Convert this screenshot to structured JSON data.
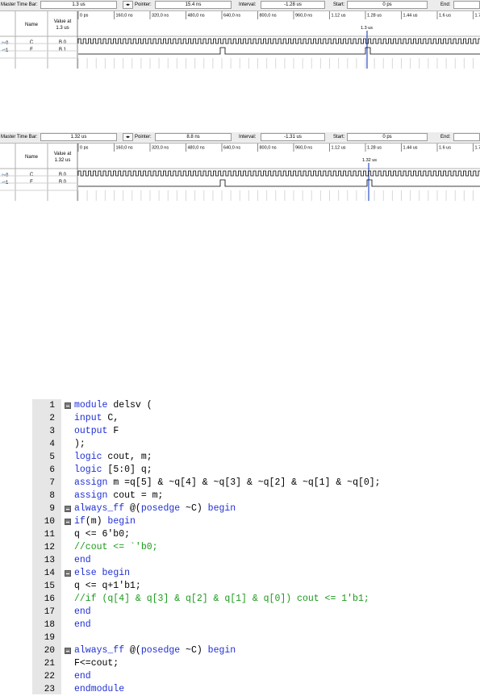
{
  "panels": [
    {
      "master_time_bar_label": "Master Time Bar:",
      "master_time_bar_value": "1.3 us",
      "pointer_label": "Pointer:",
      "pointer_value": "15.4 ns",
      "interval_label": "Interval:",
      "interval_value": "-1.28 us",
      "start_label": "Start:",
      "start_value": "0 ps",
      "end_label": "End:",
      "end_value": "",
      "name_header": "Name",
      "value_header": "Value at",
      "value_header_time": "1.3 us",
      "time_ticks": [
        "0 ps",
        "160,0 ns",
        "320,0 ns",
        "480,0 ns",
        "640,0 ns",
        "800,0 ns",
        "960,0 ns",
        "1.12 us",
        "1.28 us",
        "1.44 us",
        "1.6 us",
        "1.76 us"
      ],
      "cursor_label": "1.3 us",
      "signals": [
        {
          "index": "0",
          "name": "C",
          "value": "B 0"
        },
        {
          "index": "1",
          "name": "F",
          "value": "B 1"
        }
      ]
    },
    {
      "master_time_bar_label": "Master Time Bar:",
      "master_time_bar_value": "1.32 us",
      "pointer_label": "Pointer:",
      "pointer_value": "8.8 ns",
      "interval_label": "Interval:",
      "interval_value": "-1.31 us",
      "start_label": "Start:",
      "start_value": "0 ps",
      "end_label": "End:",
      "end_value": "",
      "name_header": "Name",
      "value_header": "Value at",
      "value_header_time": "1.32 us",
      "time_ticks": [
        "0 ps",
        "160,0 ns",
        "320,0 ns",
        "480,0 ns",
        "640,0 ns",
        "800,0 ns",
        "960,0 ns",
        "1.12 us",
        "1.28 us",
        "1.44 us",
        "1.6 us",
        "1.76 us"
      ],
      "cursor_label": "1.32 us",
      "signals": [
        {
          "index": "0",
          "name": "C",
          "value": "B 0"
        },
        {
          "index": "1",
          "name": "F",
          "value": "B 0"
        }
      ]
    }
  ],
  "code_lines": [
    {
      "n": "1",
      "fold": true,
      "segs": [
        [
          "kw",
          "module"
        ],
        [
          "pl",
          " delsv ("
        ]
      ]
    },
    {
      "n": "2",
      "fold": false,
      "segs": [
        [
          "kw",
          "input"
        ],
        [
          "pl",
          " C,"
        ]
      ]
    },
    {
      "n": "3",
      "fold": false,
      "segs": [
        [
          "kw",
          "output"
        ],
        [
          "pl",
          " F"
        ]
      ]
    },
    {
      "n": "4",
      "fold": false,
      "segs": [
        [
          "pl",
          ");"
        ]
      ]
    },
    {
      "n": "5",
      "fold": false,
      "segs": [
        [
          "kw",
          "logic"
        ],
        [
          "pl",
          " cout, m;"
        ]
      ]
    },
    {
      "n": "6",
      "fold": false,
      "segs": [
        [
          "kw",
          "logic"
        ],
        [
          "pl",
          " [5:0] q;"
        ]
      ]
    },
    {
      "n": "7",
      "fold": false,
      "segs": [
        [
          "kw",
          "assign"
        ],
        [
          "pl",
          " m =q[5] & ~q[4] & ~q[3] & ~q[2] & ~q[1] & ~q[0];"
        ]
      ]
    },
    {
      "n": "8",
      "fold": false,
      "segs": [
        [
          "kw",
          "assign"
        ],
        [
          "pl",
          " cout = m;"
        ]
      ]
    },
    {
      "n": "9",
      "fold": true,
      "segs": [
        [
          "kw",
          "always_ff"
        ],
        [
          "pl",
          " @("
        ],
        [
          "kw",
          "posedge"
        ],
        [
          "pl",
          " ~C) "
        ],
        [
          "kw",
          "begin"
        ]
      ]
    },
    {
      "n": "10",
      "fold": true,
      "segs": [
        [
          "kw",
          "if"
        ],
        [
          "pl",
          "(m) "
        ],
        [
          "kw",
          "begin"
        ]
      ]
    },
    {
      "n": "11",
      "fold": false,
      "segs": [
        [
          "pl",
          "q <= 6'b0;"
        ]
      ]
    },
    {
      "n": "12",
      "fold": false,
      "segs": [
        [
          "cm",
          "//cout <= `'b0;"
        ]
      ]
    },
    {
      "n": "13",
      "fold": false,
      "segs": [
        [
          "kw",
          "end"
        ]
      ]
    },
    {
      "n": "14",
      "fold": true,
      "segs": [
        [
          "kw",
          "else"
        ],
        [
          "pl",
          " "
        ],
        [
          "kw",
          "begin"
        ]
      ]
    },
    {
      "n": "15",
      "fold": false,
      "segs": [
        [
          "pl",
          "q <= q+1'b1;"
        ]
      ]
    },
    {
      "n": "16",
      "fold": false,
      "segs": [
        [
          "cm",
          "//if (q[4] & q[3] & q[2] & q[1] & q[0]) cout <= 1'b1;"
        ]
      ]
    },
    {
      "n": "17",
      "fold": false,
      "segs": [
        [
          "kw",
          "end"
        ]
      ]
    },
    {
      "n": "18",
      "fold": false,
      "segs": [
        [
          "kw",
          "end"
        ]
      ]
    },
    {
      "n": "19",
      "fold": false,
      "segs": []
    },
    {
      "n": "20",
      "fold": true,
      "segs": [
        [
          "kw",
          "always_ff"
        ],
        [
          "pl",
          " @("
        ],
        [
          "kw",
          "posedge"
        ],
        [
          "pl",
          " ~C) "
        ],
        [
          "kw",
          "begin"
        ]
      ]
    },
    {
      "n": "21",
      "fold": false,
      "segs": [
        [
          "pl",
          "F<=cout;"
        ]
      ]
    },
    {
      "n": "22",
      "fold": false,
      "segs": [
        [
          "kw",
          "end"
        ]
      ]
    },
    {
      "n": "23",
      "fold": false,
      "segs": [
        [
          "kw",
          "endmodule"
        ]
      ]
    }
  ]
}
